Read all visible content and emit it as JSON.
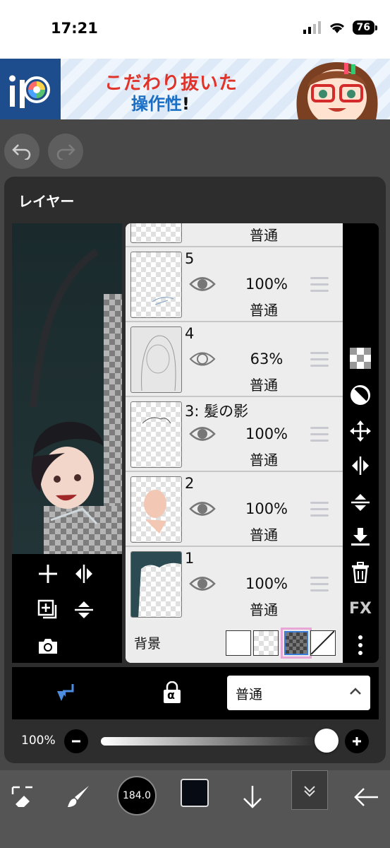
{
  "status_bar": {
    "time": "17:21",
    "battery": "76"
  },
  "ad": {
    "line1": "こだわり抜いた",
    "line2_blue": "操作性",
    "line2_mark": "!"
  },
  "layer_panel": {
    "title": "レイヤー",
    "partial_top_blend": "普通",
    "layers": [
      {
        "name": "5",
        "opacity": "100%",
        "blend": "普通",
        "visible": true
      },
      {
        "name": "4",
        "opacity": "63%",
        "blend": "普通",
        "visible": true
      },
      {
        "name": "3: 髪の影",
        "opacity": "100%",
        "blend": "普通",
        "visible": true
      },
      {
        "name": "2",
        "opacity": "100%",
        "blend": "普通",
        "visible": true
      },
      {
        "name": "1",
        "opacity": "100%",
        "blend": "普通",
        "visible": true
      }
    ],
    "background_label": "背景",
    "right_tools": {
      "fx_label": "FX"
    }
  },
  "layer_options": {
    "blend_mode": "普通",
    "alpha_label": "α"
  },
  "opacity": {
    "label": "100%",
    "value": 1.0
  },
  "toolbar": {
    "brush_size": "184.0",
    "color": "#060b14"
  }
}
